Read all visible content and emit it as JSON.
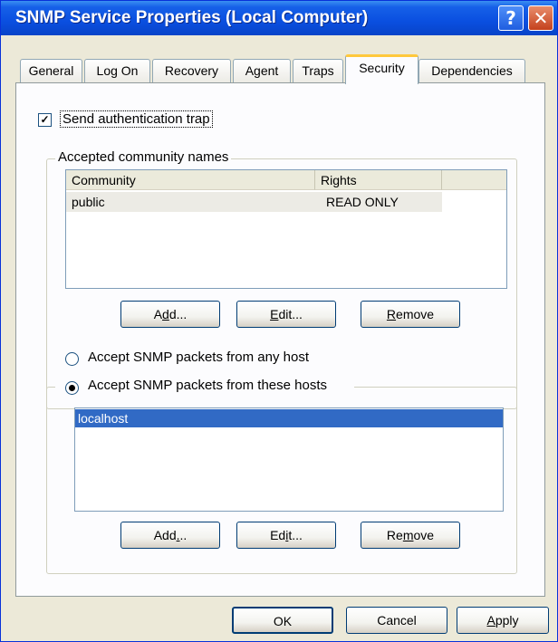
{
  "window": {
    "title": "SNMP Service Properties (Local Computer)"
  },
  "tabs": [
    {
      "label": "General"
    },
    {
      "label": "Log On"
    },
    {
      "label": "Recovery"
    },
    {
      "label": "Agent"
    },
    {
      "label": "Traps"
    },
    {
      "label": "Security",
      "active": true
    },
    {
      "label": "Dependencies"
    }
  ],
  "security": {
    "send_auth_trap": {
      "label": "Send authentication trap",
      "checked": true
    },
    "community_group": {
      "legend": "Accepted community names",
      "columns": [
        "Community",
        "Rights"
      ],
      "rows": [
        {
          "community": "public",
          "rights": "READ ONLY"
        }
      ],
      "buttons": {
        "add": "Add...",
        "edit": "Edit...",
        "remove": "Remove"
      }
    },
    "accept_any_host": {
      "label": "Accept SNMP packets from any host",
      "selected": false
    },
    "accept_these_hosts": {
      "label": "Accept SNMP packets from these hosts",
      "selected": true,
      "hosts": [
        "localhost"
      ],
      "buttons": {
        "add": "Add...",
        "edit": "Edit...",
        "remove": "Remove"
      }
    }
  },
  "footer": {
    "ok": "OK",
    "cancel": "Cancel",
    "apply": "Apply"
  },
  "colors": {
    "titlebar": "#0a4fe0",
    "selection": "#316ac5",
    "tab_highlight": "#ffc83c"
  }
}
